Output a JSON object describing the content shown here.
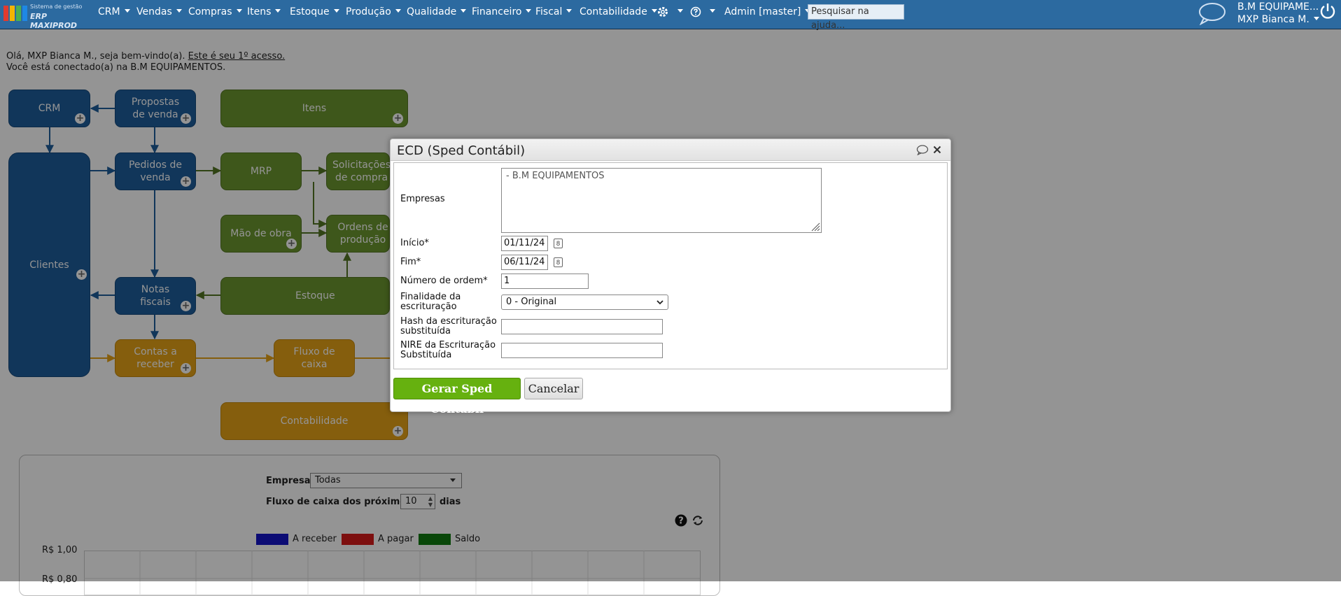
{
  "topbar": {
    "logo_line1": "Sistema de gestão",
    "logo_line2": "ERP MAXIPROD",
    "menu": [
      "CRM",
      "Vendas",
      "Compras",
      "Itens",
      "Estoque",
      "Produção",
      "Qualidade",
      "Financeiro",
      "Fiscal",
      "Contabilidade"
    ],
    "admin_label": "Admin [master]",
    "help_search_placeholder": "Pesquisar na ajuda...",
    "company_short": "B.M EQUIPAME...",
    "user_short": "MXP Bianca M."
  },
  "greeting": {
    "line1_prefix": "Olá, MXP Bianca M., seja bem-vindo(a). ",
    "line1_link": "Este é seu 1º acesso.",
    "line2": "Você está conectado(a) na B.M EQUIPAMENTOS."
  },
  "flow": {
    "crm": "CRM",
    "propostas": "Propostas de venda",
    "itens": "Itens",
    "clientes": "Clientes",
    "pedidos": "Pedidos de venda",
    "mrp": "MRP",
    "solicitacoes": "Solicitações de compra",
    "mao_obra": "Mão de obra",
    "ordens": "Ordens de produção",
    "notas": "Notas fiscais",
    "estoque": "Estoque",
    "contas_receber": "Contas a receber",
    "fluxo_caixa": "Fluxo de caixa",
    "contabilidade": "Contabilidade",
    "plus": "+"
  },
  "cashflow": {
    "empresa_label": "Empresa",
    "empresa_value": "Todas",
    "fluxo_label": "Fluxo de caixa dos próximos",
    "dias_value": "10",
    "dias_label": "dias",
    "legend": [
      {
        "name": "A receber",
        "color": "#1414c8"
      },
      {
        "name": "A pagar",
        "color": "#d81b1b"
      },
      {
        "name": "Saldo",
        "color": "#117a11"
      }
    ],
    "y_ticks": [
      "R$ 1,00",
      "R$ 0,80"
    ]
  },
  "dialog": {
    "title": "ECD (Sped Contábil)",
    "empresas_label": "Empresas",
    "empresas_value": "- B.M EQUIPAMENTOS",
    "inicio_label": "Início*",
    "inicio_value": "01/11/24",
    "fim_label": "Fim*",
    "fim_value": "06/11/24",
    "numero_label": "Número de ordem*",
    "numero_value": "1",
    "finalidade_label_1": "Finalidade da",
    "finalidade_label_2": "escrituração",
    "finalidade_value": "0 - Original",
    "hash_label_1": "Hash da escrituração",
    "hash_label_2": "substituída",
    "nire_label_1": "NIRE da Escrituração",
    "nire_label_2": "Substituída",
    "generate_button": "Gerar Sped Contábil",
    "cancel_button": "Cancelar"
  }
}
